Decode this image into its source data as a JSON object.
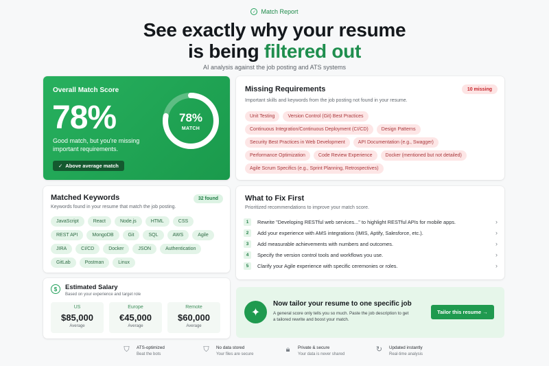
{
  "header": {
    "badge": "Match Report",
    "title_line1": "See exactly why your resume",
    "title_line2_prefix": "is being ",
    "title_line2_highlight": "filtered out",
    "subtitle": "AI analysis against the job posting and ATS systems"
  },
  "score": {
    "label": "Overall Match Score",
    "percent_text": "78%",
    "percent_value": 78,
    "description": "Good match, but you're missing important requirements.",
    "ring_percent": "78%",
    "ring_label": "MATCH",
    "pill": "Above average match"
  },
  "missing": {
    "title": "Missing Requirements",
    "subtitle": "Important skills and keywords from the job posting not found in your resume.",
    "count": "10 missing",
    "tags": [
      "Unit Testing",
      "Version Control (Git) Best Practices",
      "Continuous Integration/Continuous Deployment (CI/CD)",
      "Design Patterns",
      "Security Best Practices in Web Development",
      "API Documentation (e.g., Swagger)",
      "Performance Optimization",
      "Code Review Experience",
      "Docker (mentioned but not detailed)",
      "Agile Scrum Specifics (e.g., Sprint Planning, Retrospectives)"
    ]
  },
  "matched": {
    "title": "Matched Keywords",
    "subtitle": "Keywords found in your resume that match the job posting.",
    "count": "32 found",
    "tags": [
      "JavaScript",
      "React",
      "Node.js",
      "HTML",
      "CSS",
      "REST API",
      "MongoDB",
      "Git",
      "SQL",
      "AWS",
      "Agile",
      "JIRA",
      "CI/CD",
      "Docker",
      "JSON",
      "Authentication",
      "GitLab",
      "Postman",
      "Linux"
    ]
  },
  "fix": {
    "title": "What to Fix First",
    "subtitle": "Prioritized recommendations to improve your match score.",
    "items": [
      {
        "num": "1",
        "text": "Rewrite \"Developing RESTful web services...\" to highlight RESTful APIs for mobile apps."
      },
      {
        "num": "2",
        "text": "Add your experience with AMS integrations (IMIS, Aptify, Salesforce, etc.)."
      },
      {
        "num": "3",
        "text": "Add measurable achievements with numbers and outcomes."
      },
      {
        "num": "4",
        "text": "Specify the version control tools and workflows you use."
      },
      {
        "num": "5",
        "text": "Clarify your Agile experience with specific ceremonies or roles."
      }
    ]
  },
  "salary": {
    "icon": "$",
    "title": "Estimated Salary",
    "subtitle": "Based on your experience and target role",
    "regions": [
      {
        "region": "US",
        "value": "$85,000",
        "note": "Average"
      },
      {
        "region": "Europe",
        "value": "€45,000",
        "note": "Average"
      },
      {
        "region": "Remote",
        "value": "$60,000",
        "note": "Average"
      }
    ]
  },
  "tailor": {
    "title": "Now tailor your resume to one specific job",
    "description": "A general score only tells you so much. Paste the job description to get a tailored rewrite and boost your match.",
    "button": "Tailor this resume →"
  },
  "features": [
    {
      "icon": "shield-check-icon",
      "title": "ATS-optimized",
      "sub": "Beat the bots"
    },
    {
      "icon": "shield-icon",
      "title": "No data stored",
      "sub": "Your files are secure"
    },
    {
      "icon": "lock-icon",
      "title": "Private & secure",
      "sub": "Your data is never shared"
    },
    {
      "icon": "refresh-icon",
      "title": "Updated instantly",
      "sub": "Real-time analysis"
    }
  ],
  "colors": {
    "brand_green": "#1f9a4f",
    "missing_red": "#c6262c",
    "background": "#f7f8f9"
  }
}
